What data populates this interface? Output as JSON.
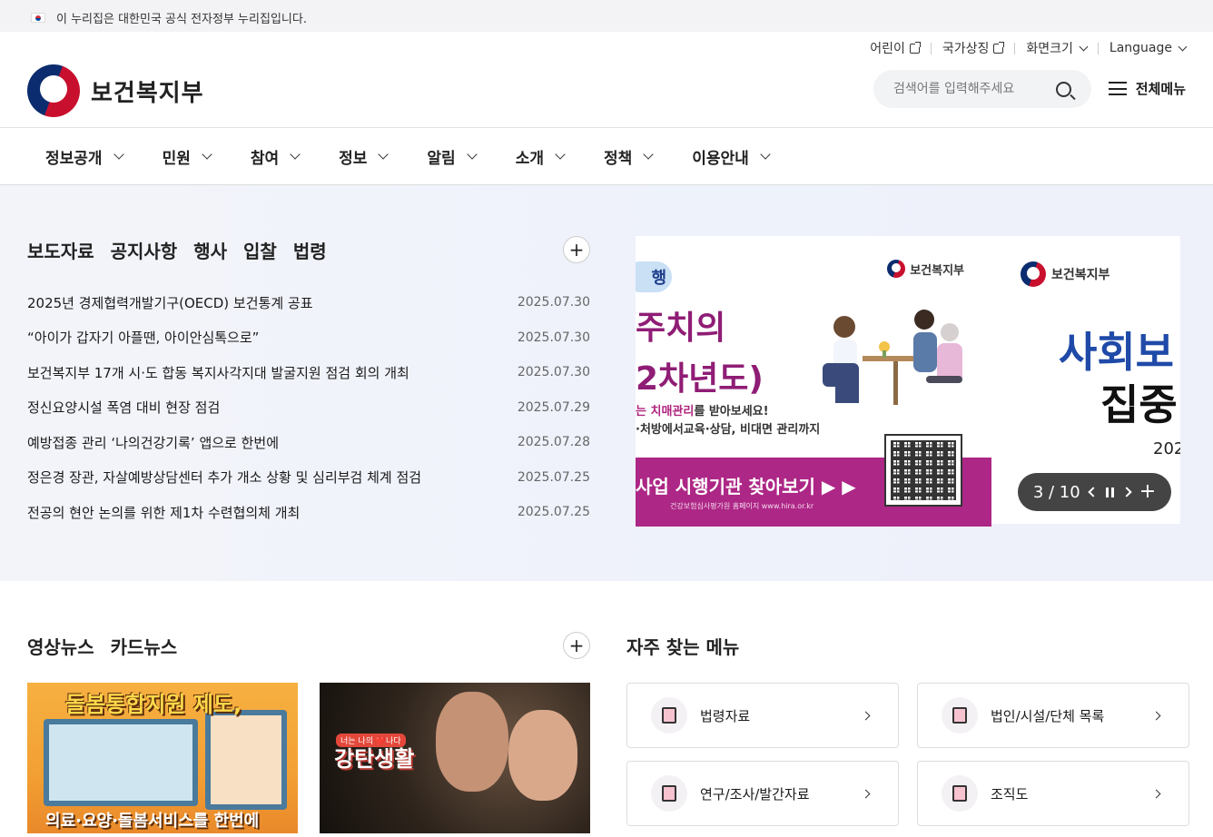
{
  "gov_banner": {
    "text": "이 누리집은 대한민국 공식 전자정부 누리집입니다."
  },
  "utility": {
    "kids": "어린이",
    "symbols": "국가상징",
    "screen_size": "화면크기",
    "language": "Language"
  },
  "header": {
    "logo_text": "보건복지부",
    "search_placeholder": "검색어를 입력해주세요",
    "all_menu": "전체메뉴"
  },
  "gnb": [
    {
      "label": "정보공개"
    },
    {
      "label": "민원"
    },
    {
      "label": "참여"
    },
    {
      "label": "정보"
    },
    {
      "label": "알림"
    },
    {
      "label": "소개"
    },
    {
      "label": "정책"
    },
    {
      "label": "이용안내"
    }
  ],
  "news": {
    "tabs": [
      "보도자료",
      "공지사항",
      "행사",
      "입찰",
      "법령"
    ],
    "more": "+",
    "items": [
      {
        "title": "2025년 경제협력개발기구(OECD) 보건통계 공표",
        "date": "2025.07.30"
      },
      {
        "title": "“아이가 갑자기 아플땐, 아이안심톡으로”",
        "date": "2025.07.30"
      },
      {
        "title": "보건복지부 17개 시·도 합동 복지사각지대 발굴지원 점검 회의 개최",
        "date": "2025.07.30"
      },
      {
        "title": "정신요양시설 폭염 대비 현장 점검",
        "date": "2025.07.29"
      },
      {
        "title": "예방접종 관리 ‘나의건강기록’ 앱으로 한번에",
        "date": "2025.07.28"
      },
      {
        "title": "정은경 장관, 자살예방상담센터 추가 개소 상황 및 심리부검 체계 점검",
        "date": "2025.07.25"
      },
      {
        "title": "전공의 현안 논의를 위한 제1차 수련협의체 개최",
        "date": "2025.07.25"
      }
    ]
  },
  "banner": {
    "pill": "행",
    "logo": "보건복지부",
    "line1": "주치의",
    "line2": "2차년도)",
    "sub1_hl": "는 치매관리",
    "sub1_rest": "를 받아보세요!",
    "sub2": "·처방에서교육·상담, 비대면 관리까지",
    "strip_text": "사업 시행기관 찾아보기 ▶ ▶",
    "strip_small": "건강보험심사평가원 홈페이지 www.hira.or.kr"
  },
  "banner2": {
    "logo": "보건복지부",
    "line1": "사회보",
    "line2": "집중",
    "line3": "202"
  },
  "slider": {
    "current": "3",
    "total": "10",
    "counter": "3 / 10"
  },
  "media": {
    "tabs": [
      "영상뉴스",
      "카드뉴스"
    ],
    "more": "+",
    "thumb1_title": "돌봄통합지원 제도,",
    "thumb1_sub": "의료·요양·돌봄서비스를 한번에",
    "thumb2_small": "너는 나의 ❤️나다",
    "thumb2_title": "강탄생활"
  },
  "quick": {
    "title": "자주 찾는 메뉴",
    "items": [
      {
        "label": "법령자료"
      },
      {
        "label": "법인/시설/단체 목록"
      },
      {
        "label": "연구/조사/발간자료"
      },
      {
        "label": "조직도"
      }
    ]
  }
}
